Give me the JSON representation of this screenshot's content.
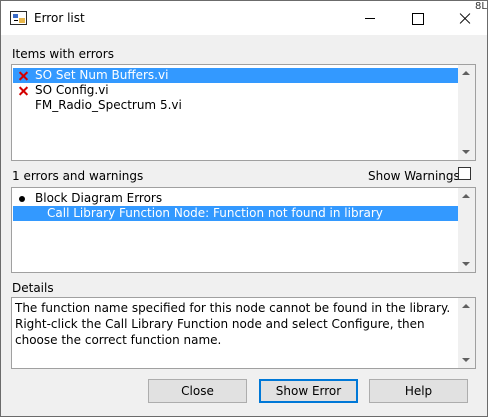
{
  "window": {
    "title": "Error list",
    "corner_fragment": "8L"
  },
  "items_section": {
    "label": "Items with errors",
    "items": [
      {
        "label": "SO Set Num Buffers.vi",
        "has_error": true,
        "selected": true
      },
      {
        "label": "SO Config.vi",
        "has_error": true,
        "selected": false
      },
      {
        "label": "FM_Radio_Spectrum 5.vi",
        "has_error": false,
        "selected": false
      }
    ]
  },
  "errors_section": {
    "label": "1 errors and warnings",
    "show_warnings_label": "Show Warnings",
    "show_warnings_checked": false,
    "group": "Block Diagram Errors",
    "entries": [
      {
        "label": "Call Library Function Node: Function not found in library",
        "selected": true
      }
    ]
  },
  "details_section": {
    "label": "Details",
    "text": "The function name specified for this node cannot be found in the library. Right-click the Call Library Function node and select Configure, then choose the correct function name."
  },
  "buttons": {
    "close": "Close",
    "show_error": "Show Error",
    "help": "Help"
  },
  "colors": {
    "selection": "#3399ff",
    "error_icon": "#d40000",
    "default_button_border": "#0078d7"
  }
}
